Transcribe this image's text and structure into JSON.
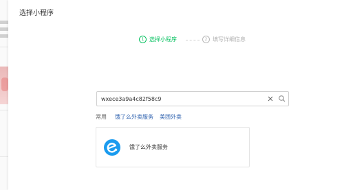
{
  "dialog": {
    "title": "选择小程序"
  },
  "steps": [
    {
      "number": "1",
      "label": "选择小程序"
    },
    {
      "number": "2",
      "label": "填写详细信息"
    }
  ],
  "search": {
    "value": "wxece3a9a4c82f58c9"
  },
  "tags": {
    "label": "常用",
    "items": [
      "饿了么外卖服务",
      "美团外卖"
    ]
  },
  "result": {
    "name": "饿了么外卖服务"
  },
  "colors": {
    "accent": "#07c160",
    "link": "#2b5fae",
    "logo": "#1a9bef"
  }
}
